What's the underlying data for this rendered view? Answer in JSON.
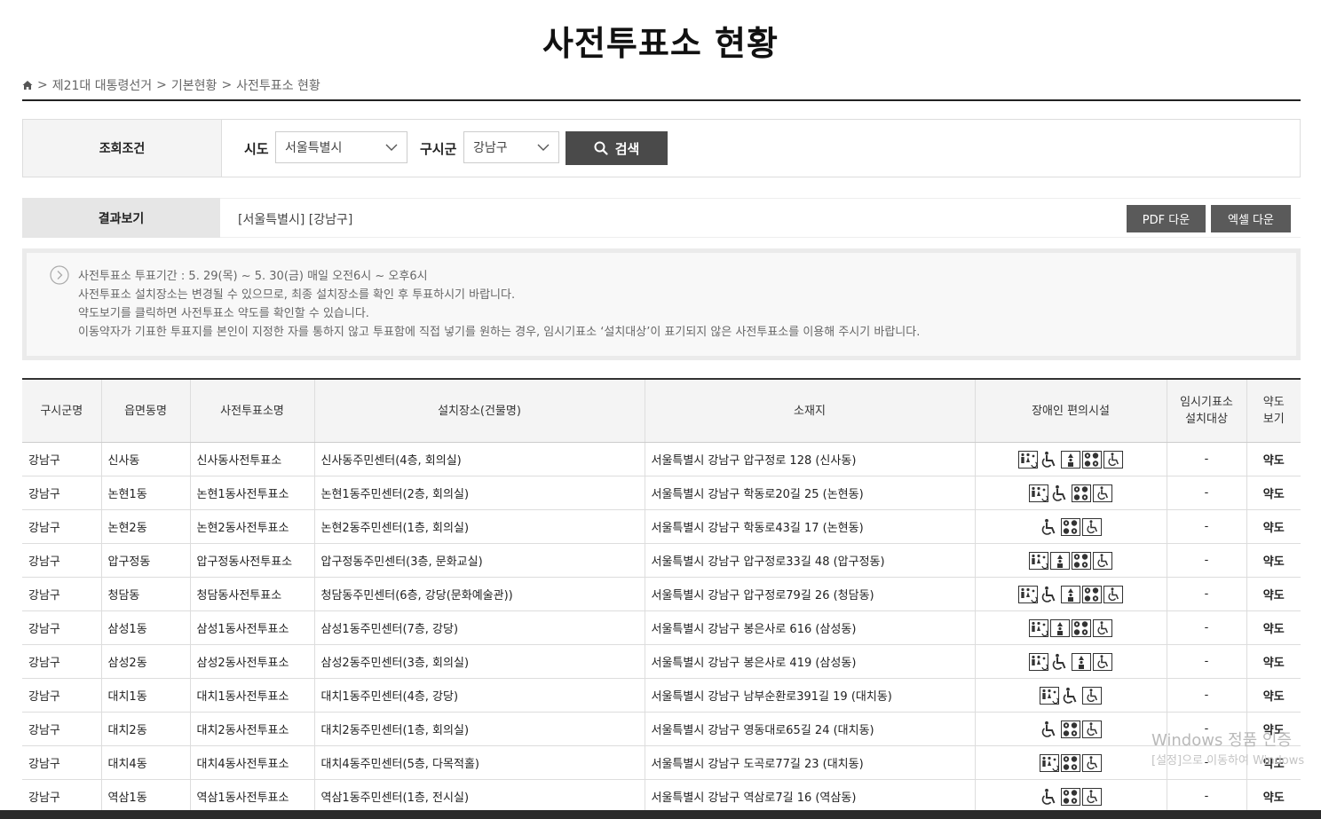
{
  "page": {
    "title": "사전투표소 현황"
  },
  "breadcrumb": {
    "items": [
      "제21대 대통령선거",
      "기본현황",
      "사전투표소 현황"
    ],
    "sep": ">"
  },
  "search": {
    "label": "조회조건",
    "sido_label": "시도",
    "sido_value": "서울특별시",
    "sigungu_label": "구시군",
    "sigungu_value": "강남구",
    "button": "검색"
  },
  "result": {
    "label": "결과보기",
    "text": "[서울특별시] [강남구]",
    "pdf": "PDF 다운",
    "excel": "엑셀 다운"
  },
  "notice": {
    "lines": [
      "사전투표소 투표기간 : 5. 29(목) ~ 5. 30(금) 매일 오전6시 ~ 오후6시",
      "사전투표소 설치장소는 변경될 수 있으므로, 최종 설치장소를 확인 후 투표하시기 바랍니다.",
      "약도보기를 클릭하면 사전투표소 약도를 확인할 수 있습니다.",
      "이동약자가 기표한 투표지를 본인이 지정한 자를 통하지 않고 투표함에 직접 넣기를 원하는 경우, 임시기표소 ‘설치대상’이 표기되지 않은 사전투표소를 이용해 주시기 바랍니다."
    ]
  },
  "table": {
    "headers": {
      "gu": "구시군명",
      "dong": "읍면동명",
      "station": "사전투표소명",
      "place": "설치장소(건물명)",
      "address": "소재지",
      "facility": "장애인 편의시설",
      "temp_line1": "임시기표소",
      "temp_line2": "설치대상",
      "map_line1": "약도",
      "map_line2": "보기"
    },
    "rows": [
      {
        "gu": "강남구",
        "dong": "신사동",
        "station": "신사동사전투표소",
        "place": "신사동주민센터(4층, 회의실)",
        "address": "서울특별시 강남구 압구정로 128 (신사동)",
        "icons": [
          "restroom-icon",
          "wheelchair-icon",
          "elevator-icon",
          "braille-icon",
          "ramp-icon"
        ],
        "temp": "-",
        "map": "약도"
      },
      {
        "gu": "강남구",
        "dong": "논현1동",
        "station": "논현1동사전투표소",
        "place": "논현1동주민센터(2층, 회의실)",
        "address": "서울특별시 강남구 학동로20길 25 (논현동)",
        "icons": [
          "restroom-icon",
          "wheelchair-icon",
          "braille-icon",
          "ramp-icon"
        ],
        "temp": "-",
        "map": "약도"
      },
      {
        "gu": "강남구",
        "dong": "논현2동",
        "station": "논현2동사전투표소",
        "place": "논현2동주민센터(1층, 회의실)",
        "address": "서울특별시 강남구 학동로43길 17 (논현동)",
        "icons": [
          "wheelchair-icon",
          "braille-icon",
          "ramp-icon"
        ],
        "temp": "-",
        "map": "약도"
      },
      {
        "gu": "강남구",
        "dong": "압구정동",
        "station": "압구정동사전투표소",
        "place": "압구정동주민센터(3층, 문화교실)",
        "address": "서울특별시 강남구 압구정로33길 48 (압구정동)",
        "icons": [
          "restroom-icon",
          "elevator-icon",
          "braille-icon",
          "ramp-icon"
        ],
        "temp": "-",
        "map": "약도"
      },
      {
        "gu": "강남구",
        "dong": "청담동",
        "station": "청담동사전투표소",
        "place": "청담동주민센터(6층, 강당(문화예술관))",
        "address": "서울특별시 강남구 압구정로79길 26 (청담동)",
        "icons": [
          "restroom-icon",
          "wheelchair-icon",
          "elevator-icon",
          "braille-icon",
          "ramp-icon"
        ],
        "temp": "-",
        "map": "약도"
      },
      {
        "gu": "강남구",
        "dong": "삼성1동",
        "station": "삼성1동사전투표소",
        "place": "삼성1동주민센터(7층, 강당)",
        "address": "서울특별시 강남구 봉은사로 616 (삼성동)",
        "icons": [
          "restroom-icon",
          "elevator-icon",
          "braille-icon",
          "ramp-icon"
        ],
        "temp": "-",
        "map": "약도"
      },
      {
        "gu": "강남구",
        "dong": "삼성2동",
        "station": "삼성2동사전투표소",
        "place": "삼성2동주민센터(3층, 회의실)",
        "address": "서울특별시 강남구 봉은사로 419 (삼성동)",
        "icons": [
          "restroom-icon",
          "wheelchair-icon",
          "elevator-icon",
          "ramp-icon"
        ],
        "temp": "-",
        "map": "약도"
      },
      {
        "gu": "강남구",
        "dong": "대치1동",
        "station": "대치1동사전투표소",
        "place": "대치1동주민센터(4층, 강당)",
        "address": "서울특별시 강남구 남부순환로391길 19 (대치동)",
        "icons": [
          "restroom-icon",
          "wheelchair-icon",
          "ramp-icon"
        ],
        "temp": "-",
        "map": "약도"
      },
      {
        "gu": "강남구",
        "dong": "대치2동",
        "station": "대치2동사전투표소",
        "place": "대치2동주민센터(1층, 회의실)",
        "address": "서울특별시 강남구 영동대로65길 24 (대치동)",
        "icons": [
          "wheelchair-icon",
          "braille-icon",
          "ramp-icon"
        ],
        "temp": "-",
        "map": "약도"
      },
      {
        "gu": "강남구",
        "dong": "대치4동",
        "station": "대치4동사전투표소",
        "place": "대치4동주민센터(5층, 다목적홀)",
        "address": "서울특별시 강남구 도곡로77길 23 (대치동)",
        "icons": [
          "restroom-icon",
          "braille-icon",
          "ramp-icon"
        ],
        "temp": "-",
        "map": "약도"
      },
      {
        "gu": "강남구",
        "dong": "역삼1동",
        "station": "역삼1동사전투표소",
        "place": "역삼1동주민센터(1층, 전시실)",
        "address": "서울특별시 강남구 역삼로7길 16 (역삼동)",
        "icons": [
          "wheelchair-icon",
          "braille-icon",
          "ramp-icon"
        ],
        "temp": "-",
        "map": "약도"
      }
    ]
  },
  "watermark": {
    "line1": "Windows 정품 인증",
    "line2": "[설정]으로 이동하여 Windows"
  }
}
